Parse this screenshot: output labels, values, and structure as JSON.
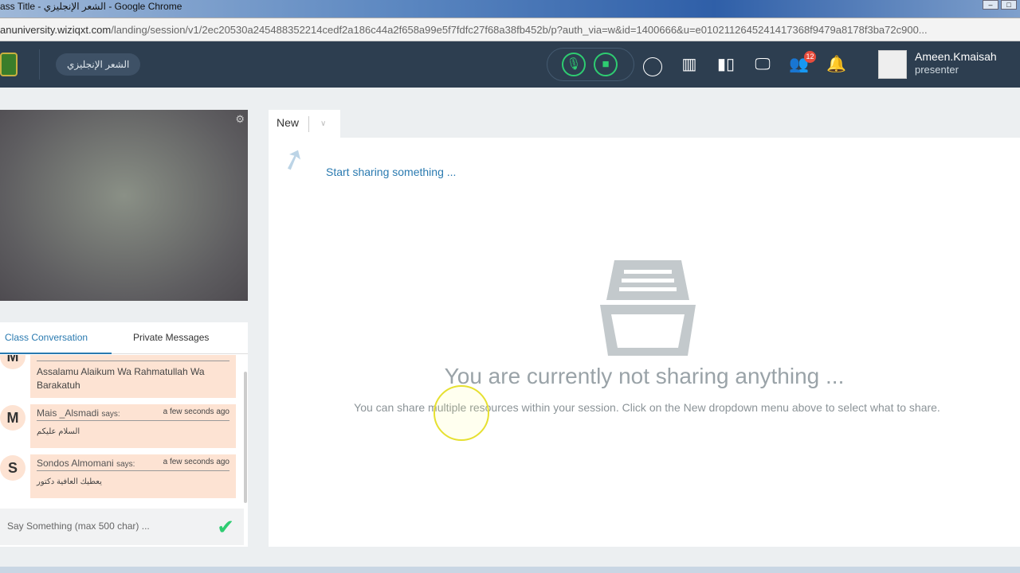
{
  "browser": {
    "title": "ass Title - الشعر الإنجليزي - Google Chrome",
    "url_host": "anuniversity.wiziqxt.com",
    "url_path": "/landing/session/v1/2ec20530a245488352214cedf2a186c44a2f658a99e5f7fdfc27f68a38fb452b/p?auth_via=w&id=1400666&u=e0102112645241417368f9479a8178f3ba72c900..."
  },
  "header": {
    "class_title": "الشعر الإنجليزي",
    "participants_count": "12",
    "user_name": "Ameen.Kmaisah",
    "user_role": "presenter"
  },
  "chat": {
    "tabs": [
      "Class Conversation",
      "Private Messages"
    ],
    "messages": [
      {
        "initial": "M",
        "author": "",
        "says": "",
        "time": "",
        "text": "Assalamu Alaikum Wa Rahmatullah Wa Barakatuh"
      },
      {
        "initial": "M",
        "author": "Mais _Alsmadi",
        "says": "says:",
        "time": "a few seconds ago",
        "text": "السلام عليكم"
      },
      {
        "initial": "S",
        "author": "Sondos Almomani",
        "says": "says:",
        "time": "a few seconds ago",
        "text": "يعطيك العافية دكتور"
      }
    ],
    "input_placeholder": "Say Something (max 500 char) ..."
  },
  "content": {
    "tab_label": "New",
    "start_sharing": "Start sharing something ...",
    "empty_title": "You are currently not sharing anything ...",
    "empty_desc": "You can share multiple resources within your session. Click on the New dropdown menu above to select what to share."
  }
}
